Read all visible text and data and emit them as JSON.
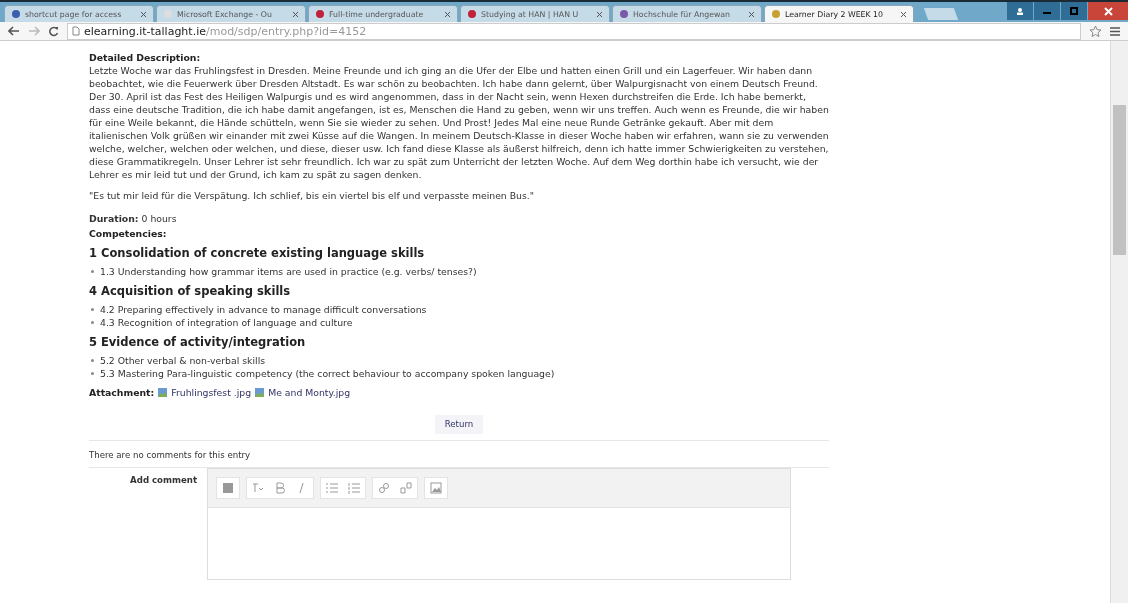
{
  "browser": {
    "tabs": [
      {
        "title": "shortcut page for access",
        "selected": false
      },
      {
        "title": "Microsoft Exchange - Ou",
        "selected": false
      },
      {
        "title": "Full-time undergraduate",
        "selected": false
      },
      {
        "title": "Studying at HAN | HAN U",
        "selected": false
      },
      {
        "title": "Hochschule für Angewan",
        "selected": false
      },
      {
        "title": "Learner Diary 2 WEEK 10",
        "selected": true
      }
    ],
    "address": {
      "host": "elearning.it-tallaght.ie",
      "path": "/mod/sdp/entry.php?id=4152"
    }
  },
  "entry": {
    "description_label": "Detailed Description:",
    "description": "Letzte Woche war das Fruhlingsfest in Dresden. Meine Freunde und ich ging an die Ufer der Elbe und hatten einen Grill und ein Lagerfeuer. Wir haben dann beobachtet, wie die Feuerwerk über Dresden Altstadt. Es war schön zu beobachten. Ich habe dann gelernt, über Walpurgisnacht von einem Deutsch Freund. Der 30. April ist das Fest des Heiligen Walpurgis und es wird angenommen, dass in der Nacht sein, wenn Hexen durchstreifen die Erde. Ich habe bemerkt, dass eine deutsche Tradition, die ich habe damit angefangen, ist es, Menschen die Hand zu geben, wenn wir uns treffen. Auch wenn es Freunde, die wir haben für eine Weile bekannt, die Hände schütteln, wenn Sie sie wieder zu sehen. Und Prost! Jedes Mal eine neue Runde Getränke gekauft. Aber mit dem italienischen Volk grüßen wir einander mit zwei Küsse auf die Wangen. In meinem Deutsch-Klasse in dieser Woche haben wir erfahren, wann sie zu verwenden welche, welcher, welchen oder welchen, und diese, dieser usw. Ich fand diese Klasse als äußerst hilfreich, denn ich hatte immer Schwierigkeiten zu verstehen, diese Grammatikregeln. Unser Lehrer ist sehr freundlich. Ich war zu spät zum Unterricht der letzten Woche. Auf dem Weg dorthin habe ich versucht, wie der Lehrer es mir leid tut und der Grund, ich kam zu spät zu sagen denken.",
    "quote": "\"Es tut mir leid für die Verspätung. Ich schlief, bis ein viertel bis elf und verpasste meinen Bus.\"",
    "duration": "**Duration:** 0 hours",
    "competencies_label": "Competencies:",
    "competencies": [
      {
        "heading": "1 Consolidation of concrete existing language skills",
        "items": [
          "1.3 Understanding how grammar items are used in practice (e.g. verbs/ tenses?)"
        ]
      },
      {
        "heading": "4 Acquisition of speaking skills",
        "items": [
          "4.2 Preparing effectively in advance to manage difficult conversations",
          "4.3 Recognition of integration of language and culture"
        ]
      },
      {
        "heading": "5 Evidence of activity/integration",
        "items": [
          "5.2 Other verbal & non-verbal skills",
          "5.3 Mastering Para-linguistic competency (the correct behaviour to accompany spoken language)"
        ]
      }
    ],
    "attachment_label": "Attachment:",
    "attachments": [
      "Fruhlingsfest .jpg",
      "Me and Monty.jpg"
    ],
    "return_button": "Return"
  },
  "comments": {
    "empty_message": "There are no comments for this entry",
    "add_label": "Add comment"
  }
}
